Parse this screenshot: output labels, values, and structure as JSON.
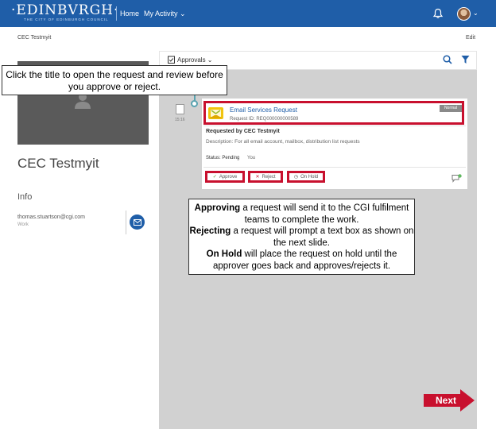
{
  "header": {
    "logo_text": "·EDINBVRGH·",
    "logo_subtitle": "THE CITY OF EDINBURGH COUNCIL",
    "nav": {
      "home": "Home",
      "my_activity": "My Activity ⌄"
    },
    "icons": [
      "bell-icon",
      "user-avatar"
    ]
  },
  "subheader": {
    "user_name": "CEC Testmyit",
    "edit": "Edit"
  },
  "profile": {
    "name": "CEC Testmyit",
    "info_heading": "Info",
    "email": "thomas.stuartson@cgi.com",
    "email_type": "Work"
  },
  "approvals": {
    "filter_label": "Approvals ⌄",
    "time": "15:16",
    "card": {
      "title": "Email Services Request",
      "request_id": "Request ID: REQ000000000589",
      "priority": "Normal",
      "requested_by": "Requested by CEC Testmyit",
      "description": "Description: For all email account, mailbox, distribution list requests",
      "status_label": "Status: Pending",
      "status_value": "You",
      "buttons": {
        "approve": "Approve",
        "reject": "Reject",
        "on_hold": "On Hold"
      }
    }
  },
  "callouts": {
    "top": "Click the title to open the request and review before you approve or reject.",
    "approving_bold": "Approving",
    "approving_text": " a request will send it to the CGI fulfilment teams to complete the work.",
    "rejecting_bold": "Rejecting",
    "rejecting_text": " a request will prompt a text box as shown on the next slide.",
    "onhold_bold": "On Hold",
    "onhold_text": " will place the request on hold until the approver goes back and approves/rejects it."
  },
  "next_button": "Next",
  "colors": {
    "header_blue": "#1f5ea8",
    "highlight_red": "#c8102e",
    "timeline_teal": "#59a3b0",
    "panel_grey": "#d1d1d1"
  }
}
